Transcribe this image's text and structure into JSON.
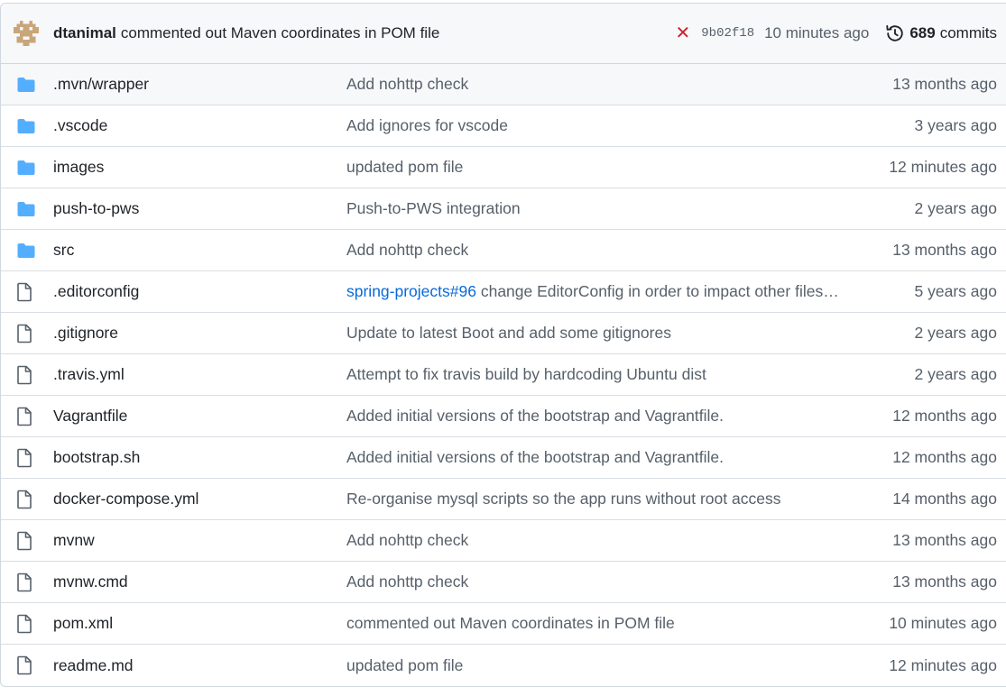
{
  "latest_commit": {
    "author": "dtanimal",
    "message": "commented out Maven coordinates in POM file",
    "status": "failure",
    "sha": "9b02f18",
    "time_ago": "10 minutes ago",
    "commits_count": "689",
    "commits_label": "commits"
  },
  "files": [
    {
      "type": "folder",
      "name": ".mvn/wrapper",
      "message_link": "",
      "message": "Add nohttp check",
      "age": "13 months ago"
    },
    {
      "type": "folder",
      "name": ".vscode",
      "message_link": "",
      "message": "Add ignores for vscode",
      "age": "3 years ago"
    },
    {
      "type": "folder",
      "name": "images",
      "message_link": "",
      "message": "updated pom file",
      "age": "12 minutes ago"
    },
    {
      "type": "folder",
      "name": "push-to-pws",
      "message_link": "",
      "message": "Push-to-PWS integration",
      "age": "2 years ago"
    },
    {
      "type": "folder",
      "name": "src",
      "message_link": "",
      "message": "Add nohttp check",
      "age": "13 months ago"
    },
    {
      "type": "file",
      "name": ".editorconfig",
      "message_link": "spring-projects#96",
      "message": " change EditorConfig in order to impact other files…",
      "age": "5 years ago"
    },
    {
      "type": "file",
      "name": ".gitignore",
      "message_link": "",
      "message": "Update to latest Boot and add some gitignores",
      "age": "2 years ago"
    },
    {
      "type": "file",
      "name": ".travis.yml",
      "message_link": "",
      "message": "Attempt to fix travis build by hardcoding Ubuntu dist",
      "age": "2 years ago"
    },
    {
      "type": "file",
      "name": "Vagrantfile",
      "message_link": "",
      "message": "Added initial versions of the bootstrap and Vagrantfile.",
      "age": "12 months ago"
    },
    {
      "type": "file",
      "name": "bootstrap.sh",
      "message_link": "",
      "message": "Added initial versions of the bootstrap and Vagrantfile.",
      "age": "12 months ago"
    },
    {
      "type": "file",
      "name": "docker-compose.yml",
      "message_link": "",
      "message": "Re-organise mysql scripts so the app runs without root access",
      "age": "14 months ago"
    },
    {
      "type": "file",
      "name": "mvnw",
      "message_link": "",
      "message": "Add nohttp check",
      "age": "13 months ago"
    },
    {
      "type": "file",
      "name": "mvnw.cmd",
      "message_link": "",
      "message": "Add nohttp check",
      "age": "13 months ago"
    },
    {
      "type": "file",
      "name": "pom.xml",
      "message_link": "",
      "message": "commented out Maven coordinates in POM file",
      "age": "10 minutes ago"
    },
    {
      "type": "file",
      "name": "readme.md",
      "message_link": "",
      "message": "updated pom file",
      "age": "12 minutes ago"
    }
  ],
  "colors": {
    "folder": "#54aeff",
    "link": "#0969da",
    "failure": "#cf222e",
    "muted": "#57606a",
    "header_bg": "#f6f8fa"
  }
}
